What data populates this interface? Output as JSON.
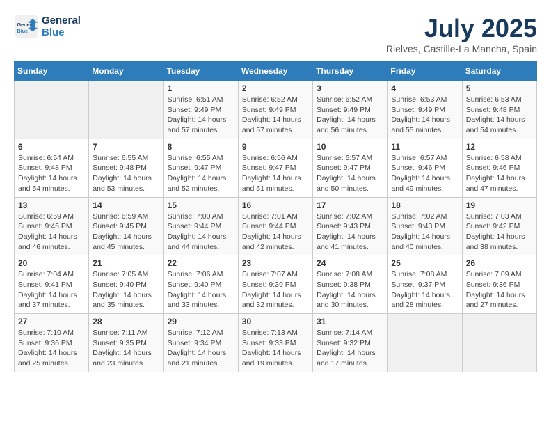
{
  "header": {
    "logo_line1": "General",
    "logo_line2": "Blue",
    "month": "July 2025",
    "location": "Rielves, Castille-La Mancha, Spain"
  },
  "weekdays": [
    "Sunday",
    "Monday",
    "Tuesday",
    "Wednesday",
    "Thursday",
    "Friday",
    "Saturday"
  ],
  "weeks": [
    [
      {
        "day": "",
        "info": ""
      },
      {
        "day": "",
        "info": ""
      },
      {
        "day": "1",
        "info": "Sunrise: 6:51 AM\nSunset: 9:49 PM\nDaylight: 14 hours and 57 minutes."
      },
      {
        "day": "2",
        "info": "Sunrise: 6:52 AM\nSunset: 9:49 PM\nDaylight: 14 hours and 57 minutes."
      },
      {
        "day": "3",
        "info": "Sunrise: 6:52 AM\nSunset: 9:49 PM\nDaylight: 14 hours and 56 minutes."
      },
      {
        "day": "4",
        "info": "Sunrise: 6:53 AM\nSunset: 9:49 PM\nDaylight: 14 hours and 55 minutes."
      },
      {
        "day": "5",
        "info": "Sunrise: 6:53 AM\nSunset: 9:48 PM\nDaylight: 14 hours and 54 minutes."
      }
    ],
    [
      {
        "day": "6",
        "info": "Sunrise: 6:54 AM\nSunset: 9:48 PM\nDaylight: 14 hours and 54 minutes."
      },
      {
        "day": "7",
        "info": "Sunrise: 6:55 AM\nSunset: 9:48 PM\nDaylight: 14 hours and 53 minutes."
      },
      {
        "day": "8",
        "info": "Sunrise: 6:55 AM\nSunset: 9:47 PM\nDaylight: 14 hours and 52 minutes."
      },
      {
        "day": "9",
        "info": "Sunrise: 6:56 AM\nSunset: 9:47 PM\nDaylight: 14 hours and 51 minutes."
      },
      {
        "day": "10",
        "info": "Sunrise: 6:57 AM\nSunset: 9:47 PM\nDaylight: 14 hours and 50 minutes."
      },
      {
        "day": "11",
        "info": "Sunrise: 6:57 AM\nSunset: 9:46 PM\nDaylight: 14 hours and 49 minutes."
      },
      {
        "day": "12",
        "info": "Sunrise: 6:58 AM\nSunset: 9:46 PM\nDaylight: 14 hours and 47 minutes."
      }
    ],
    [
      {
        "day": "13",
        "info": "Sunrise: 6:59 AM\nSunset: 9:45 PM\nDaylight: 14 hours and 46 minutes."
      },
      {
        "day": "14",
        "info": "Sunrise: 6:59 AM\nSunset: 9:45 PM\nDaylight: 14 hours and 45 minutes."
      },
      {
        "day": "15",
        "info": "Sunrise: 7:00 AM\nSunset: 9:44 PM\nDaylight: 14 hours and 44 minutes."
      },
      {
        "day": "16",
        "info": "Sunrise: 7:01 AM\nSunset: 9:44 PM\nDaylight: 14 hours and 42 minutes."
      },
      {
        "day": "17",
        "info": "Sunrise: 7:02 AM\nSunset: 9:43 PM\nDaylight: 14 hours and 41 minutes."
      },
      {
        "day": "18",
        "info": "Sunrise: 7:02 AM\nSunset: 9:43 PM\nDaylight: 14 hours and 40 minutes."
      },
      {
        "day": "19",
        "info": "Sunrise: 7:03 AM\nSunset: 9:42 PM\nDaylight: 14 hours and 38 minutes."
      }
    ],
    [
      {
        "day": "20",
        "info": "Sunrise: 7:04 AM\nSunset: 9:41 PM\nDaylight: 14 hours and 37 minutes."
      },
      {
        "day": "21",
        "info": "Sunrise: 7:05 AM\nSunset: 9:40 PM\nDaylight: 14 hours and 35 minutes."
      },
      {
        "day": "22",
        "info": "Sunrise: 7:06 AM\nSunset: 9:40 PM\nDaylight: 14 hours and 33 minutes."
      },
      {
        "day": "23",
        "info": "Sunrise: 7:07 AM\nSunset: 9:39 PM\nDaylight: 14 hours and 32 minutes."
      },
      {
        "day": "24",
        "info": "Sunrise: 7:08 AM\nSunset: 9:38 PM\nDaylight: 14 hours and 30 minutes."
      },
      {
        "day": "25",
        "info": "Sunrise: 7:08 AM\nSunset: 9:37 PM\nDaylight: 14 hours and 28 minutes."
      },
      {
        "day": "26",
        "info": "Sunrise: 7:09 AM\nSunset: 9:36 PM\nDaylight: 14 hours and 27 minutes."
      }
    ],
    [
      {
        "day": "27",
        "info": "Sunrise: 7:10 AM\nSunset: 9:36 PM\nDaylight: 14 hours and 25 minutes."
      },
      {
        "day": "28",
        "info": "Sunrise: 7:11 AM\nSunset: 9:35 PM\nDaylight: 14 hours and 23 minutes."
      },
      {
        "day": "29",
        "info": "Sunrise: 7:12 AM\nSunset: 9:34 PM\nDaylight: 14 hours and 21 minutes."
      },
      {
        "day": "30",
        "info": "Sunrise: 7:13 AM\nSunset: 9:33 PM\nDaylight: 14 hours and 19 minutes."
      },
      {
        "day": "31",
        "info": "Sunrise: 7:14 AM\nSunset: 9:32 PM\nDaylight: 14 hours and 17 minutes."
      },
      {
        "day": "",
        "info": ""
      },
      {
        "day": "",
        "info": ""
      }
    ]
  ]
}
